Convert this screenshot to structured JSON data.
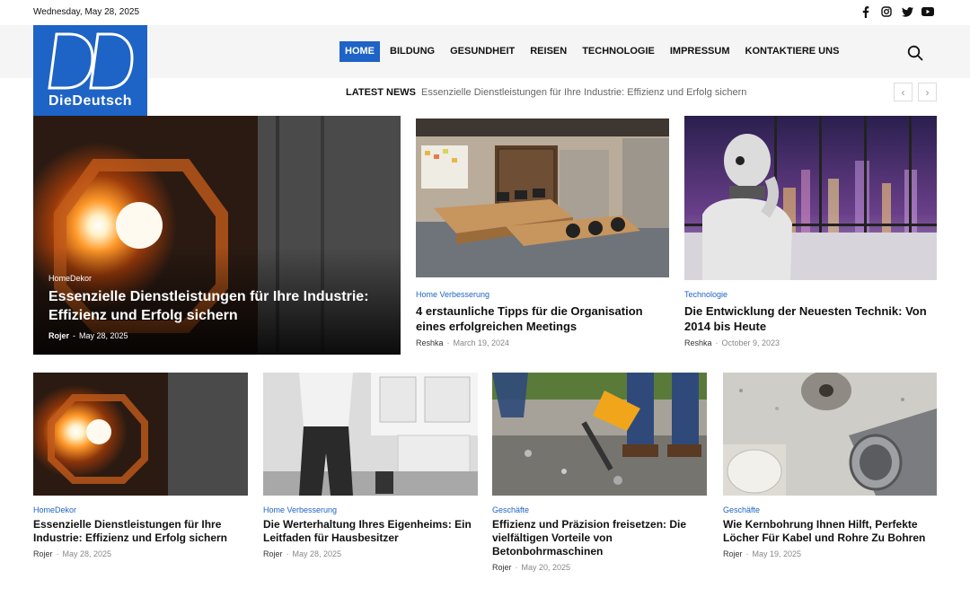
{
  "topbar": {
    "date": "Wednesday, May 28, 2025"
  },
  "social": [
    "facebook-icon",
    "instagram-icon",
    "twitter-icon",
    "youtube-icon"
  ],
  "logo": {
    "brand": "DieDeutsch",
    "letters": "DD"
  },
  "nav": [
    "HOME",
    "BILDUNG",
    "GESUNDHEIT",
    "REISEN",
    "TECHNOLOGIE",
    "IMPRESSUM",
    "KONTAKTIERE UNS"
  ],
  "ticker": {
    "label": "LATEST NEWS",
    "text": "Essenzielle Dienstleistungen für Ihre Industrie: Effizienz und Erfolg sichern",
    "prev": "‹",
    "next": "›"
  },
  "hero": {
    "category": "HomeDekor",
    "title": "Essenzielle Dienstleistungen für Ihre Industrie: Effizienz und Erfolg sichern",
    "author": "Rojer",
    "date": "May 28, 2025"
  },
  "top_cards": [
    {
      "category": "Home Verbesserung",
      "title": "4 erstaunliche Tipps für die Organisation eines erfolgreichen Meetings",
      "author": "Reshka",
      "date": "March 19, 2024"
    },
    {
      "category": "Technologie",
      "title": "Die Entwicklung der Neuesten Technik: Von 2014 bis Heute",
      "author": "Reshka",
      "date": "October 9, 2023"
    }
  ],
  "bottom_cards": [
    {
      "category": "HomeDekor",
      "title": "Essenzielle Dienstleistungen für Ihre Industrie: Effizienz und Erfolg sichern",
      "author": "Rojer",
      "date": "May 28, 2025"
    },
    {
      "category": "Home Verbesserung",
      "title": "Die Werterhaltung Ihres Eigenheims: Ein Leitfaden für Hausbesitzer",
      "author": "Rojer",
      "date": "May 28, 2025"
    },
    {
      "category": "Geschäfte",
      "title": "Effizienz und Präzision freisetzen: Die vielfältigen Vorteile von Betonbohrmaschinen",
      "author": "Rojer",
      "date": "May 20, 2025"
    },
    {
      "category": "Geschäfte",
      "title": "Wie Kernbohrung Ihnen Hilft, Perfekte Löcher Für Kabel und Rohre Zu Bohren",
      "author": "Rojer",
      "date": "May 19, 2025"
    }
  ],
  "colors": {
    "accent": "#1e63c6",
    "header_bg": "#f5f5f5"
  }
}
